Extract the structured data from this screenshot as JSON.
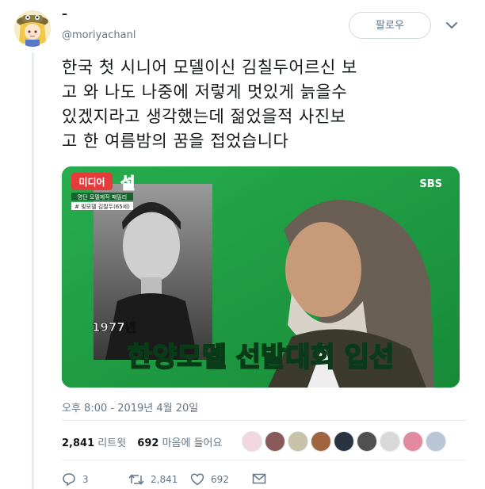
{
  "header": {
    "display_name": "–",
    "handle": "@moriyachanl",
    "follow_label": "팔로우"
  },
  "tweet": {
    "lines": [
      "한국 첫 시니어 모델이신 김칠두어르신 보",
      "고 와 나도 나중에 저렇게 멋있게 늙을수",
      "있겠지라고 생각했는데 젊었을적 사진보",
      "고 한 여름밤의 꿈을 접었습니다"
    ]
  },
  "media": {
    "show_logo_top": "미디어",
    "show_logo_main": "설",
    "show_subtitle_1": "명단 모델제작 패밀리",
    "show_subtitle_2": "# 빛모델 김칠두(65세)",
    "broadcaster": "SBS",
    "year_caption": "1977년",
    "main_caption": "한양모델 선발대회 입선"
  },
  "timestamp": "오후 8:00 - 2019년 4월 20일",
  "stats": {
    "retweets_count": "2,841",
    "retweets_label": "리트윗",
    "likes_count": "692",
    "likes_label": "마음에 들어요"
  },
  "actions": {
    "reply_count": "3",
    "retweet_count": "2,841",
    "like_count": "692"
  },
  "colors": {
    "accent_border": "#cfd9de",
    "muted_text": "#657786",
    "green_screen": "#1d9e43"
  }
}
